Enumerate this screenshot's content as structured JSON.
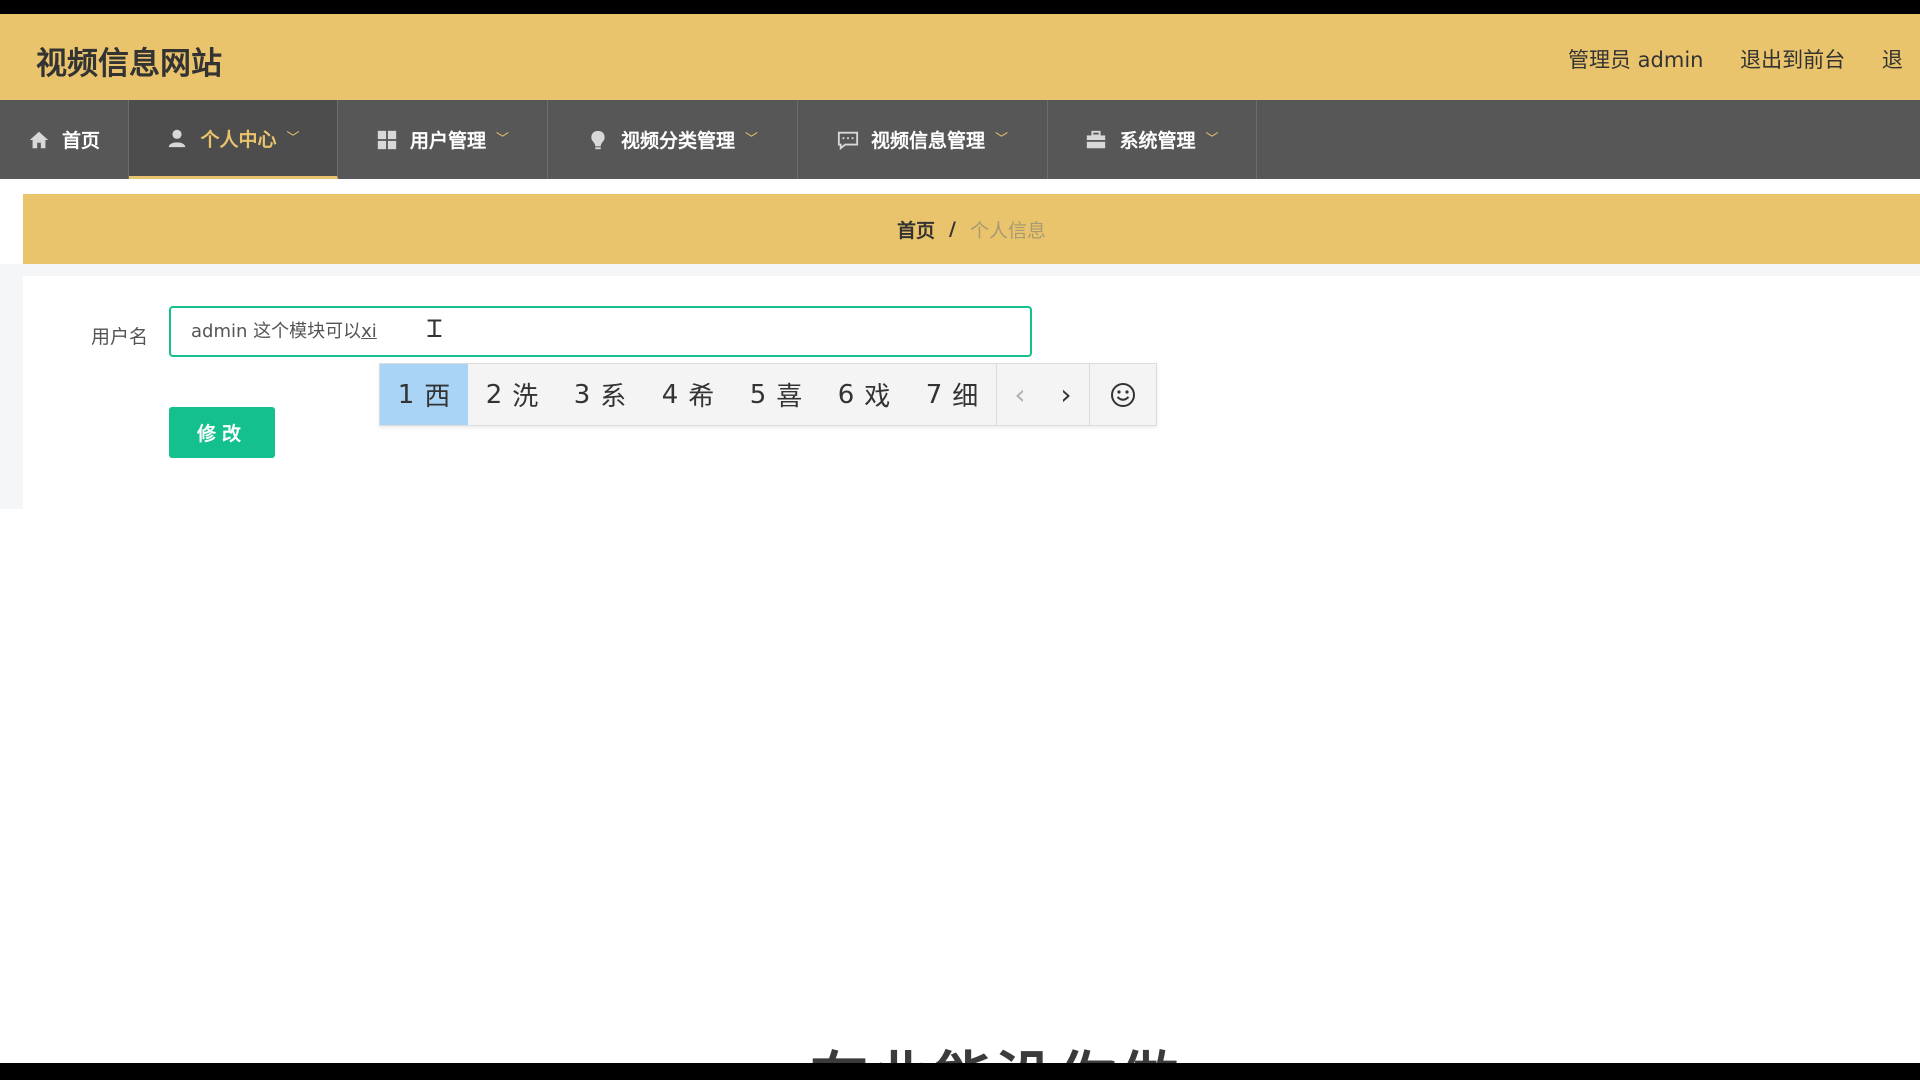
{
  "site": {
    "title": "视频信息网站"
  },
  "header": {
    "user_label": "管理员 admin",
    "front_link": "退出到前台",
    "logout_partial": "退"
  },
  "nav": {
    "items": [
      {
        "label": "首页",
        "icon": "home-icon"
      },
      {
        "label": "个人中心",
        "icon": "user-icon",
        "active": true
      },
      {
        "label": "用户管理",
        "icon": "grid-icon"
      },
      {
        "label": "视频分类管理",
        "icon": "bulb-icon"
      },
      {
        "label": "视频信息管理",
        "icon": "chat-icon"
      },
      {
        "label": "系统管理",
        "icon": "briefcase-icon"
      }
    ]
  },
  "breadcrumb": {
    "home": "首页",
    "separator": "/",
    "current": "个人信息"
  },
  "form": {
    "username_label": "用户名",
    "username_value": "admin  这个模块可以",
    "ime_composition": "xi",
    "submit_label": "修改"
  },
  "ime": {
    "candidates": [
      {
        "num": "1",
        "char": "西"
      },
      {
        "num": "2",
        "char": "洗"
      },
      {
        "num": "3",
        "char": "系"
      },
      {
        "num": "4",
        "char": "希"
      },
      {
        "num": "5",
        "char": "喜"
      },
      {
        "num": "6",
        "char": "戏"
      },
      {
        "num": "7",
        "char": "细"
      }
    ],
    "prev_arrow": "‹",
    "next_arrow": "›"
  },
  "subtitle": {
    "text": "在业能没你做"
  },
  "colors": {
    "accent": "#e9c46c",
    "nav_bg": "#575757",
    "primary": "#13c08e",
    "ime_selected": "#a9d4f5"
  }
}
